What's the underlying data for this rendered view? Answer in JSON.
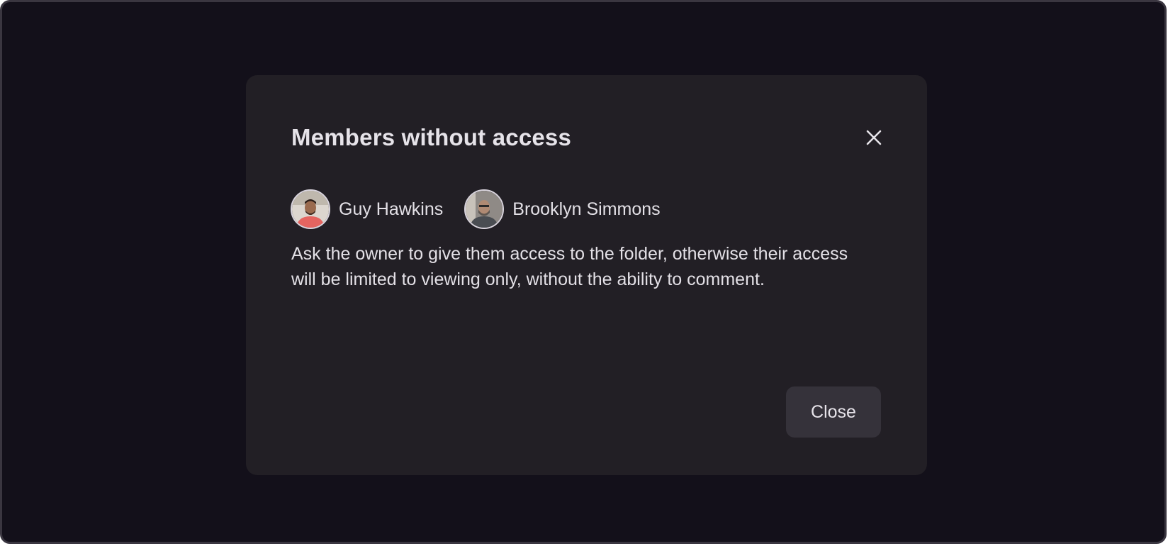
{
  "modal": {
    "title": "Members without access",
    "close_icon": "close-icon",
    "members": [
      {
        "name": "Guy Hawkins",
        "avatar": "avatar-photo"
      },
      {
        "name": "Brooklyn Simmons",
        "avatar": "avatar-photo"
      }
    ],
    "message": "Ask the owner to give them access to the folder, otherwise their access will be limited to viewing only, without the ability to comment.",
    "close_label": "Close"
  },
  "colors": {
    "background": "#13101a",
    "modal": "#221f25",
    "button": "#35323a",
    "text": "#e3e0e6"
  }
}
